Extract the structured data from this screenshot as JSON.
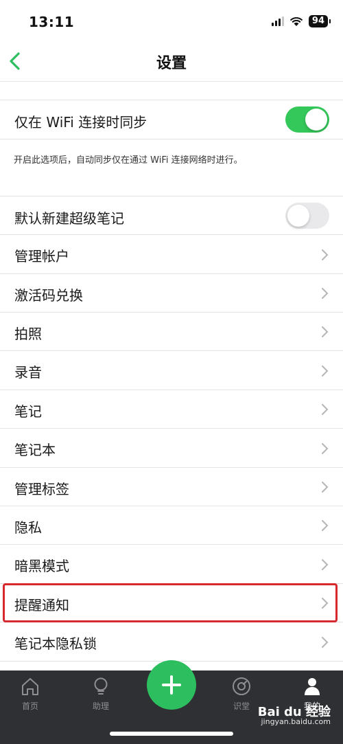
{
  "status_bar": {
    "time": "13:11",
    "battery": "94"
  },
  "nav": {
    "title": "设置",
    "back_icon": "chevron-left-icon"
  },
  "wifi_sync": {
    "label": "仅在 WiFi 连接时同步",
    "enabled": true,
    "helper": "开启此选项后，自动同步仅在通过 WiFi 连接网络时进行。"
  },
  "super_note": {
    "label": "默认新建超级笔记",
    "enabled": false
  },
  "menu_items": [
    {
      "label": "管理帐户"
    },
    {
      "label": "激活码兑换"
    },
    {
      "label": "拍照"
    },
    {
      "label": "录音"
    },
    {
      "label": "笔记"
    },
    {
      "label": "笔记本"
    },
    {
      "label": "管理标签"
    },
    {
      "label": "隐私"
    },
    {
      "label": "暗黑模式"
    },
    {
      "label": "提醒通知",
      "highlighted": true
    },
    {
      "label": "笔记本隐私锁"
    }
  ],
  "tab_bar": {
    "tabs": [
      {
        "label": "首页",
        "icon": "home-icon"
      },
      {
        "label": "助理",
        "icon": "lightbulb-icon"
      },
      {
        "label": "识堂",
        "icon": "compass-icon"
      },
      {
        "label": "我的",
        "icon": "person-icon",
        "active": true
      }
    ],
    "add_icon": "plus-icon"
  },
  "colors": {
    "accent": "#2dbe60",
    "toggle_on": "#34c759",
    "highlight": "#d6282e",
    "tab_bg": "#2f3034"
  },
  "watermark": {
    "brand": "Bai du 经验",
    "url": "jingyan.baidu.com"
  }
}
